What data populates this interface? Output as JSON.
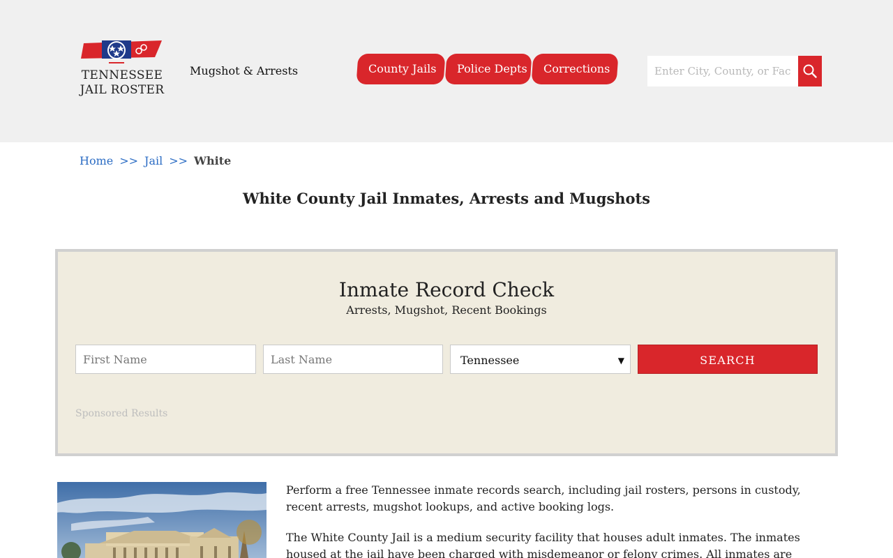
{
  "header": {
    "logo_line1": "TENNESSEE",
    "logo_line2": "JAIL ROSTER",
    "tagline": "Mugshot & Arrests",
    "nav": [
      "County Jails",
      "Police Depts",
      "Corrections"
    ],
    "search_placeholder": "Enter City, County, or Facility"
  },
  "breadcrumb": {
    "home": "Home",
    "jail": "Jail",
    "separator": ">>",
    "current": "White"
  },
  "page_title": "White County Jail Inmates, Arrests and Mugshots",
  "record_check": {
    "title": "Inmate Record Check",
    "subtitle": "Arrests, Mugshot, Recent Bookings",
    "first_name_placeholder": "First Name",
    "last_name_placeholder": "Last Name",
    "state_selected": "Tennessee",
    "search_label": "SEARCH",
    "sponsored": "Sponsored Results"
  },
  "content": {
    "paragraph1": "Perform a free Tennessee inmate records search, including jail rosters, persons in custody, recent arrests, mugshot lookups, and active booking logs.",
    "paragraph2": "The White County Jail is a medium security facility that houses adult inmates. The inmates housed at the jail have been charged with misdemeanor or felony crimes. All inmates are currently awaiting trial"
  },
  "colors": {
    "accent_red": "#d9262b",
    "header_bg": "#f0f0f0",
    "box_bg": "#f0ecdf",
    "link_blue": "#2b6cc4"
  }
}
